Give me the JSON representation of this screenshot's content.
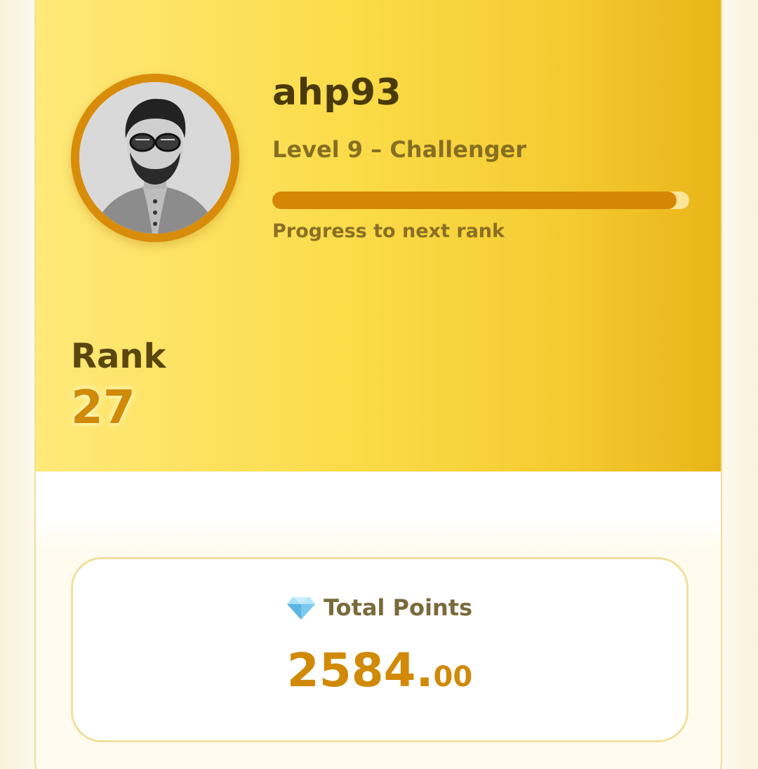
{
  "profile": {
    "username": "ahp93",
    "level": "Level 9 – Challenger",
    "progress_fraction": 0.97,
    "progress_label": "Progress to next rank",
    "avatar_icon": "user-avatar"
  },
  "rank": {
    "label": "Rank",
    "value": "27"
  },
  "points": {
    "icon": "gem-icon",
    "title": "Total Points",
    "integer": "2584.",
    "decimal": "00"
  },
  "colors": {
    "accent": "#d68605",
    "progress_track": "#fbe59a",
    "header_text": "#4a3a0a"
  }
}
